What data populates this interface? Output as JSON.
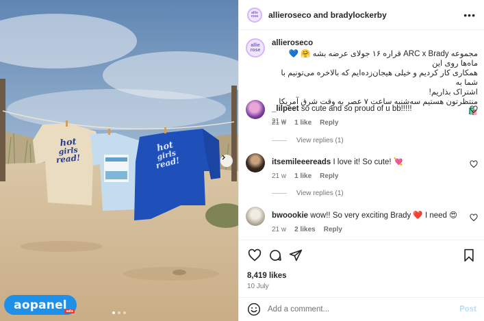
{
  "header": {
    "title": "allieroseco and bradylockerby"
  },
  "brand_avatar_text": "allie rose",
  "caption": {
    "username": "allieroseco",
    "lines": [
      "مجموعه ARC x Brady قراره ۱۶ جولای عرضه بشه 🤗 💙 ماه‌ها روی این",
      "همکاری کار کردیم و خیلی هیجان‌زده‌ایم که بالاخره می‌تونیم با شما به",
      "اشتراک بذاریم!",
      "منتظرتون هستیم سه‌شنبه ساعت ۷ عصر به وقت شرق آمریکا 🛍️"
    ],
    "age": "21 w"
  },
  "comments": [
    {
      "username": "_lilpeet",
      "text": "so cute and so proud of u bb!!!!!",
      "age": "21 w",
      "likes": "1 like",
      "reply": "Reply",
      "view_replies": "View replies (1)"
    },
    {
      "username": "itsemileeereads",
      "text": "I love it! So cute! 💘",
      "age": "21 w",
      "likes": "1 like",
      "reply": "Reply",
      "view_replies": "View replies (1)"
    },
    {
      "username": "bwoookie",
      "text": "wow!! So very exciting Brady ❤️ I need 😍",
      "age": "21 w",
      "likes": "2 likes",
      "reply": "Reply"
    }
  ],
  "likes_count": "8,419 likes",
  "post_date": "10 July",
  "add_comment": {
    "placeholder": "Add a comment...",
    "post_label": "Post"
  },
  "photo": {
    "shirt_text": "hot girls read!",
    "watermark": "aopanel",
    "watermark_tag": "ads",
    "carousel_dots": 3,
    "active_dot": 0
  },
  "icons": [
    "more-icon",
    "heart-icon",
    "comment-icon",
    "share-icon",
    "save-icon",
    "emoji-icon",
    "chevron-right-icon"
  ],
  "colors": {
    "link_post": "#b2dffc",
    "watermark_bg": "#1e90e8",
    "heart_red": "#ed4956"
  }
}
